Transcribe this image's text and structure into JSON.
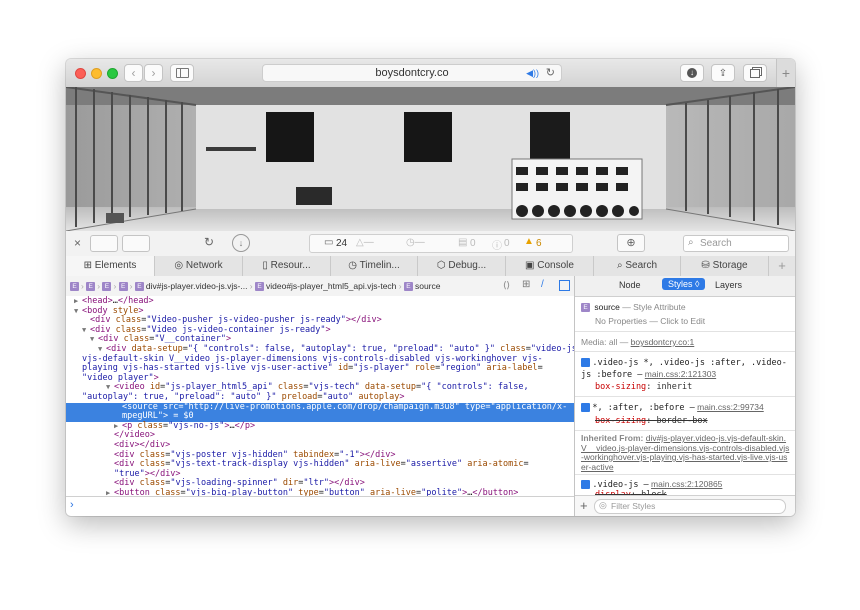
{
  "browser": {
    "address": "boysdontcry.co",
    "tab_add": "+"
  },
  "devtools": {
    "toolbar": {
      "resources_count": "24",
      "errors_count": "0",
      "logs_count": "0",
      "warnings_count": "6",
      "search_placeholder": "Search"
    },
    "tabs": [
      "Elements",
      "Network",
      "Resour...",
      "Timelin...",
      "Debug...",
      "Console",
      "Search",
      "Storage"
    ],
    "breadcrumb": {
      "items": [
        "div#js-player.video-js.vjs-...",
        "video#js-player_html5_api.vjs-tech",
        "source"
      ]
    },
    "dom_lines": [
      {
        "indent": 1,
        "arrow": "▶",
        "html": "<span class='tag'>&lt;head&gt;</span>…<span class='tag'>&lt;/head&gt;</span>"
      },
      {
        "indent": 1,
        "arrow": "▼",
        "html": "<span class='tag'>&lt;body</span> <span class='an'>style</span><span class='tag'>&gt;</span>"
      },
      {
        "indent": 2,
        "arrow": "",
        "html": "<span class='tag'>&lt;div</span> <span class='an'>class</span>=<span class='av'>\"Video-pusher js-video-pusher js-ready\"</span><span class='tag'>&gt;&lt;/div&gt;</span>"
      },
      {
        "indent": 2,
        "arrow": "▼",
        "html": "<span class='tag'>&lt;div</span> <span class='an'>class</span>=<span class='av'>\"Video js-video-container js-ready\"</span><span class='tag'>&gt;</span>"
      },
      {
        "indent": 3,
        "arrow": "▼",
        "html": "<span class='tag'>&lt;div</span> <span class='an'>class</span>=<span class='av'>\"V__container\"</span><span class='tag'>&gt;</span>"
      },
      {
        "indent": 4,
        "arrow": "▼",
        "html": "<span class='tag'>&lt;div</span> <span class='an'>data-setup</span>=<span class='av'>\"{ \"controls\": false, \"autoplay\": true, \"preload\": \"auto\" }\"</span> <span class='an'>class</span>=<span class='av'>\"video-js</span>"
      },
      {
        "indent": 0,
        "arrow": "",
        "html": "<span class='av'>vjs-default-skin V__video js-player-dimensions vjs-controls-disabled vjs-workinghover vjs-</span>"
      },
      {
        "indent": 0,
        "arrow": "",
        "html": "<span class='av'>playing vjs-has-started vjs-live vjs-user-active\"</span> <span class='an'>id</span>=<span class='av'>\"js-player\"</span> <span class='an'>role</span>=<span class='av'>\"region\"</span> <span class='an'>aria-label</span>="
      },
      {
        "indent": 0,
        "arrow": "",
        "html": "<span class='av'>\"video player\"</span><span class='tag'>&gt;</span>"
      },
      {
        "indent": 5,
        "arrow": "▼",
        "html": "<span class='tag'>&lt;video</span> <span class='an'>id</span>=<span class='av'>\"js-player_html5_api\"</span> <span class='an'>class</span>=<span class='av'>\"vjs-tech\"</span> <span class='an'>data-setup</span>=<span class='av'>\"{ \"controls\": false,</span>"
      },
      {
        "indent": 0,
        "arrow": "",
        "html": "<span class='av'>\"autoplay\": true, \"preload\": \"auto\" }\"</span> <span class='an'>preload</span>=<span class='av'>\"auto\"</span> <span class='an'>autoplay</span><span class='tag'>&gt;</span>"
      },
      {
        "indent": 6,
        "arrow": "",
        "sel": true,
        "html": "<span class='tag'>&lt;source</span> <span class='an'>src</span>=<span class='av'>\"http://live-promotions.apple.com/drop/champaign.m3u8\"</span> <span class='an'>type</span>=<span class='av'>\"application/x-</span>"
      },
      {
        "indent": 6,
        "arrow": "",
        "sel": true,
        "html": "<span class='av'>mpegURL\"</span><span class='tag'>&gt;</span> = $0"
      },
      {
        "indent": 6,
        "arrow": "▶",
        "html": "<span class='tag'>&lt;p</span> <span class='an'>class</span>=<span class='av'>\"vjs-no-js\"</span><span class='tag'>&gt;</span>…<span class='tag'>&lt;/p&gt;</span>"
      },
      {
        "indent": 5,
        "arrow": "",
        "html": "<span class='tag'>&lt;/video&gt;</span>"
      },
      {
        "indent": 5,
        "arrow": "",
        "html": "<span class='tag'>&lt;div&gt;&lt;/div&gt;</span>"
      },
      {
        "indent": 5,
        "arrow": "",
        "html": "<span class='tag'>&lt;div</span> <span class='an'>class</span>=<span class='av'>\"vjs-poster vjs-hidden\"</span> <span class='an'>tabindex</span>=<span class='av'>\"-1\"</span><span class='tag'>&gt;&lt;/div&gt;</span>"
      },
      {
        "indent": 5,
        "arrow": "",
        "html": "<span class='tag'>&lt;div</span> <span class='an'>class</span>=<span class='av'>\"vjs-text-track-display vjs-hidden\"</span> <span class='an'>aria-live</span>=<span class='av'>\"assertive\"</span> <span class='an'>aria-atomic</span>="
      },
      {
        "indent": 5,
        "arrow": "",
        "html": "<span class='av'>\"true\"</span><span class='tag'>&gt;&lt;/div&gt;</span>"
      },
      {
        "indent": 5,
        "arrow": "",
        "html": "<span class='tag'>&lt;div</span> <span class='an'>class</span>=<span class='av'>\"vjs-loading-spinner\"</span> <span class='an'>dir</span>=<span class='av'>\"ltr\"</span><span class='tag'>&gt;&lt;/div&gt;</span>"
      },
      {
        "indent": 5,
        "arrow": "▶",
        "html": "<span class='tag'>&lt;button</span> <span class='an'>class</span>=<span class='av'>\"vjs-big-play-button\"</span> <span class='an'>type</span>=<span class='av'>\"button\"</span> <span class='an'>aria-live</span>=<span class='av'>\"polite\"</span><span class='tag'>&gt;</span>…<span class='tag'>&lt;/button&gt;</span>"
      }
    ],
    "sidebar": {
      "tabs": [
        "Node",
        "Styles ◊",
        "Layers"
      ],
      "style_attr_selector": "source",
      "style_attr_title": "— Style Attribute",
      "no_props": "No Properties — Click to Edit",
      "media_label": "Media: all —",
      "media_link": "boysdontcry.co:1",
      "rule1_selector": ".video-js *, .video-js :after, .video-js :before —",
      "rule1_source": "main.css:2:121303",
      "rule1_prop": "box-sizing",
      "rule1_value": "inherit",
      "rule2_selector": "*, :after, :before —",
      "rule2_source": "main.css:2:99734",
      "rule2_prop": "box-sizing",
      "rule2_value": "border-box",
      "inherited_label": "Inherited From:",
      "inherited_link": "div#js-player.video-js.vjs-default-skin.V__video.js-player-dimensions.vjs-controls-disabled.vjs-workinghover.vjs-playing.vjs-has-started.vjs-live.vjs-user-active",
      "rule3_selector": ".video-js —",
      "rule3_source": "main.css:2:120865",
      "rule3_prop": "display",
      "rule3_value": "block",
      "filter_placeholder": "Filter Styles"
    }
  }
}
